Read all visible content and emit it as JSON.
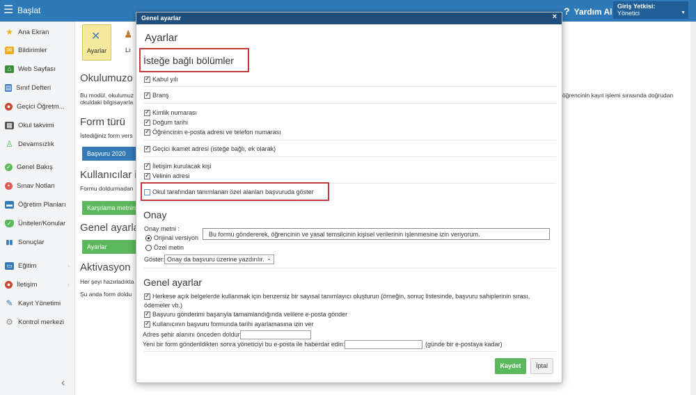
{
  "topbar": {
    "menu_icon": "hamburger-icon",
    "brand": "Başlat",
    "help_label": "Yardım Al",
    "auth_title": "Giriş Yetkisi:",
    "auth_value": "Yönetici",
    "color": "#2e7ab8"
  },
  "sidebar": {
    "items": [
      {
        "label": "Ana Ekran",
        "icon": "star-icon",
        "color": "#f0ad1a"
      },
      {
        "label": "Bildirimler",
        "icon": "envelope-icon",
        "color": "#f0ad1a"
      },
      {
        "label": "Web Sayfası",
        "icon": "home-icon",
        "color": "#3a8e3a"
      },
      {
        "label": "Sınıf Defteri",
        "icon": "book-icon",
        "color": "#3a7ac4"
      },
      {
        "label": "Geçici Öğretm...",
        "icon": "teacher-icon",
        "color": "#c8452e"
      },
      {
        "label": "Okul takvimi",
        "icon": "calendar-icon",
        "color": "#555555"
      },
      {
        "label": "Devamsızlık",
        "icon": "person-icon",
        "color": "#5cb85c"
      },
      {
        "label": "Genel Bakış",
        "icon": "check-circle-icon",
        "color": "#5cb85c"
      },
      {
        "label": "Sınav Notları",
        "icon": "grade-icon",
        "color": "#e05a5a"
      },
      {
        "label": "Öğretim Planları",
        "icon": "plan-icon",
        "color": "#337ab7"
      },
      {
        "label": "Üniteler/Konular",
        "icon": "shield-icon",
        "color": "#5cb85c"
      },
      {
        "label": "Sonuçlar",
        "icon": "bar-chart-icon",
        "color": "#337ab7"
      },
      {
        "label": "Eğitim",
        "icon": "education-icon",
        "color": "#337ab7"
      },
      {
        "label": "İletişim",
        "icon": "chat-icon",
        "color": "#c8452e"
      },
      {
        "label": "Kayıt Yönetimi",
        "icon": "pencil-icon",
        "color": "#337ab7"
      },
      {
        "label": "Kontrol merkezi",
        "icon": "gear-icon",
        "color": "#888888"
      }
    ],
    "collapse_icon": "chevron-left-icon"
  },
  "main": {
    "toolbar": {
      "settings_label": "Ayarlar",
      "list_label": "Lis"
    },
    "heading1": "Okulumuzo",
    "text1a": "Bu modül, okulumuz",
    "text1b": "okuldaki bilgisayarla",
    "right_text": "öğrencinin kayıt işlemi sırasında doğrudan",
    "heading2": "Form türü",
    "text2": "İstediğiniz form vers",
    "button_basvuru": "Başvuru 2020",
    "heading3": "Kullanıcılar iç",
    "text3": "Formu doldurmadan",
    "button_karsilama": "Karşılama metnini",
    "heading4": "Genel ayarlar",
    "button_ayarlar": "Ayarlar",
    "heading5": "Aktivasyon",
    "text5a": "Her şeyi hazırladıkta",
    "text5b": "Şu anda form doldu"
  },
  "modal": {
    "header": "Genel ayarlar",
    "close_icon": "close-icon",
    "title": "Ayarlar",
    "optional_title": "İsteğe bağlı bölümler",
    "checkboxes": [
      {
        "label": "Kabul yılı",
        "checked": true
      },
      {
        "label": "Branş",
        "checked": true
      },
      {
        "label": "Kimlik numarası",
        "checked": true
      },
      {
        "label": "Doğum tarihi",
        "checked": true
      },
      {
        "label": "Öğrencinin e-posta adresi ve telefon numarası",
        "checked": true
      },
      {
        "label": "Geçici ikamet adresi (isteğe bağlı, ek olarak)",
        "checked": true
      },
      {
        "label": "İletişim kurulacak kişi",
        "checked": true
      },
      {
        "label": "Velinin adresi",
        "checked": true
      },
      {
        "label": "Okul tarafından tanımlanan özel alanları başvuruda göster",
        "checked": false
      }
    ],
    "onay_title": "Onay",
    "onay_metni_label": "Onay metni :",
    "consent_text": "Bu formu göndererek, öğrencinin ve yasal temsilcinin kişisel verilerinin işlenmesine izin veriyorum.",
    "radio_original": "Orijinal versiyon",
    "radio_custom": "Özel metin",
    "goster_label": "Göster:",
    "goster_value": "Onay da başvuru üzerine yazdırılır.",
    "general_title": "Genel ayarlar",
    "general_checks": [
      {
        "label": "Herkese açık belgelerde kullanmak için benzersiz bir sayısal tanımlayıcı oluşturun (örneğin, sonuç listesinde, başvuru sahiplerinin sırası,",
        "checked": true
      },
      {
        "label": "ödemeler vb.)",
        "checked": true
      },
      {
        "label": "Başvuru gönderimi başarıyla tamamlandığında velilere e-posta gönder",
        "checked": true
      },
      {
        "label": "Kullanıcının başvuru formunda tarihi ayarlamasına izin ver",
        "checked": true
      }
    ],
    "city_label": "Adres şehir alanını önceden doldur",
    "notify_label": "Yeni bir form gönderildikten sonra yöneticiyi bu e-posta ile haberdar edin:",
    "notify_suffix": "(günde bir e-postaya kadar)",
    "save_label": "Kaydet",
    "cancel_label": "İptal",
    "highlight_color": "#c0393b"
  }
}
